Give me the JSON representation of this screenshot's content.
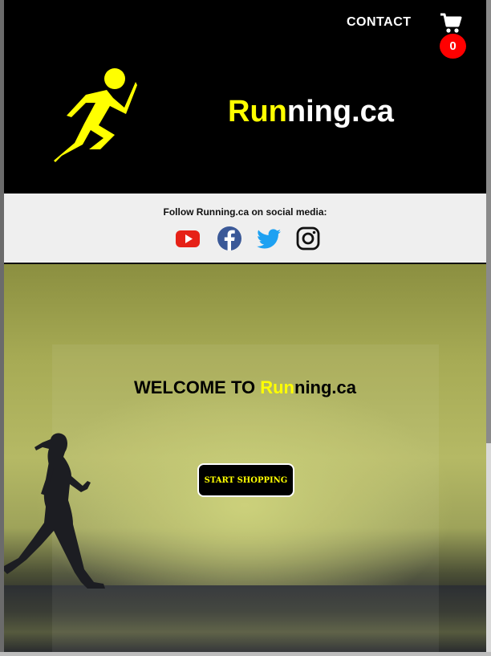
{
  "header": {
    "contact_label": "CONTACT",
    "cart_count": "0",
    "brand": {
      "highlight": "Run",
      "rest": "ning.ca"
    }
  },
  "social": {
    "label": "Follow Running.ca on social media:",
    "icons": [
      "youtube-icon",
      "facebook-icon",
      "twitter-icon",
      "instagram-icon"
    ]
  },
  "hero": {
    "welcome_prefix": "WELCOME TO ",
    "welcome_highlight": "Run",
    "welcome_rest": "ning.ca",
    "cta_label": "START SHOPPING"
  },
  "colors": {
    "highlight": "#ffff00",
    "badge": "#ff0000",
    "youtube": "#e62117",
    "facebook": "#3b5998",
    "twitter": "#1da1f2"
  }
}
